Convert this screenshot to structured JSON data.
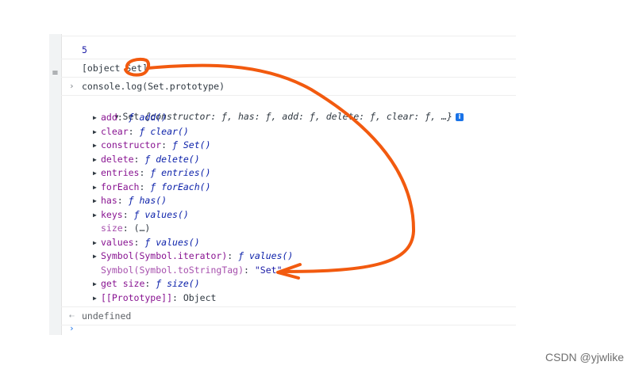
{
  "console": {
    "top_partial_text": "‹ ...",
    "gutter_mark": "≡",
    "rows": {
      "number_output": "5",
      "object_output": "[object Set]",
      "command": "console.log(Set.prototype)",
      "result": "undefined"
    },
    "tree": {
      "header_prefix": "Set ",
      "header_preview": "{constructor: ƒ, has: ƒ, add: ƒ, delete: ƒ, clear: ƒ, …}",
      "info_icon": "i",
      "entries": [
        {
          "key": "add",
          "value": "ƒ add()",
          "expandable": true
        },
        {
          "key": "clear",
          "value": "ƒ clear()",
          "expandable": true
        },
        {
          "key": "constructor",
          "value": "ƒ Set()",
          "expandable": true
        },
        {
          "key": "delete",
          "value": "ƒ delete()",
          "expandable": true
        },
        {
          "key": "entries",
          "value": "ƒ entries()",
          "expandable": true
        },
        {
          "key": "forEach",
          "value": "ƒ forEach()",
          "expandable": true
        },
        {
          "key": "has",
          "value": "ƒ has()",
          "expandable": true
        },
        {
          "key": "keys",
          "value": "ƒ values()",
          "expandable": true
        },
        {
          "key": "size",
          "value": "(…)",
          "expandable": false
        },
        {
          "key": "values",
          "value": "ƒ values()",
          "expandable": true
        },
        {
          "key": "Symbol(Symbol.iterator)",
          "value": "ƒ values()",
          "expandable": true
        },
        {
          "key": "Symbol(Symbol.toStringTag)",
          "value": "\"Set\"",
          "expandable": false
        },
        {
          "key": "get size",
          "value": "ƒ size()",
          "expandable": true
        },
        {
          "key": "[[Prototype]]",
          "value": "Object",
          "expandable": true
        }
      ]
    }
  },
  "annotation": {
    "color": "#f25a0f"
  },
  "watermark": "CSDN @yjwlike"
}
